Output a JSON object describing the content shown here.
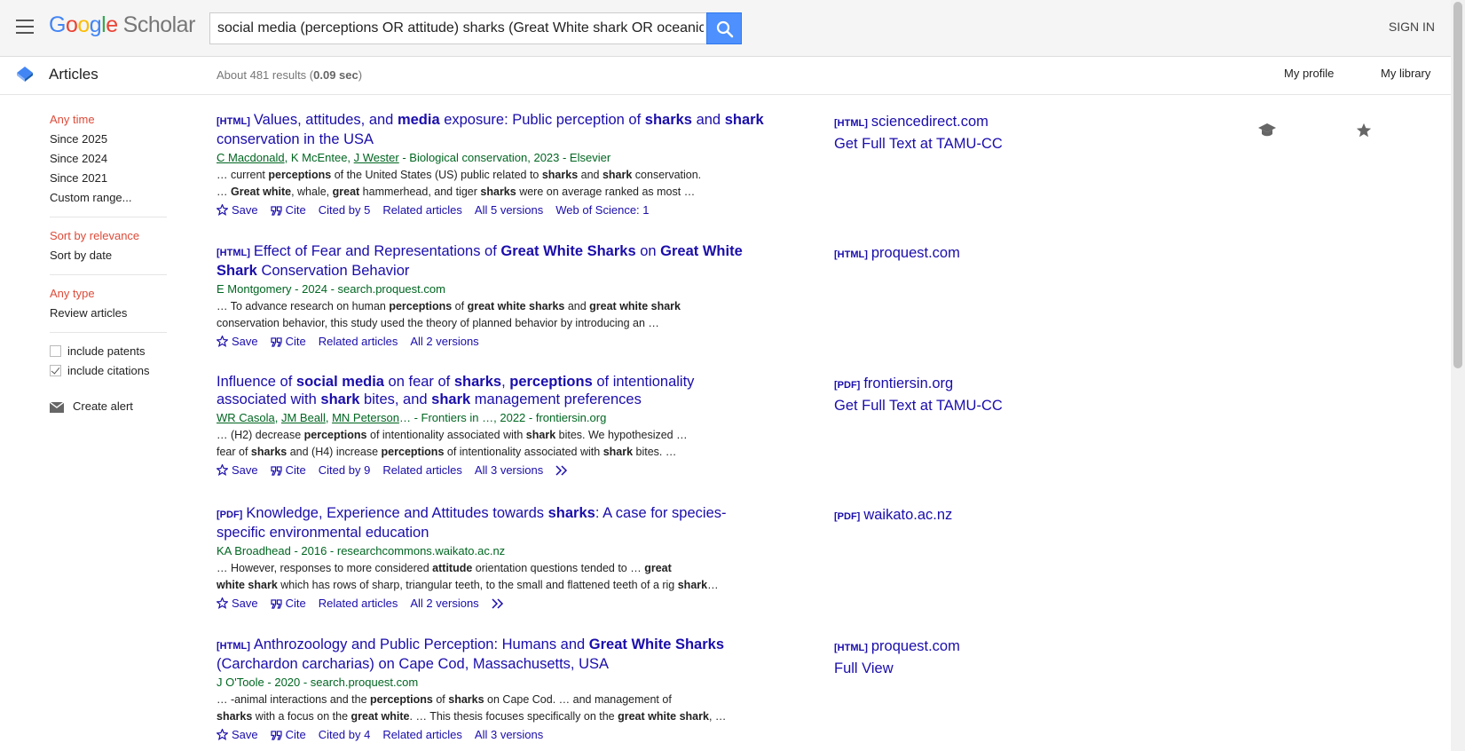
{
  "header": {
    "logo_google": "Google",
    "logo_scholar": "Scholar",
    "search_value": "social media (perceptions OR attitude) sharks (Great White shark OR oceanic",
    "sign_in": "SIGN IN"
  },
  "subheader": {
    "section": "Articles",
    "results_prefix": "About 481 results (",
    "results_time": "0.09 sec",
    "results_suffix": ")",
    "my_profile": "My profile",
    "my_library": "My library"
  },
  "sidebar": {
    "time": [
      "Any time",
      "Since 2025",
      "Since 2024",
      "Since 2021",
      "Custom range..."
    ],
    "sort": [
      "Sort by relevance",
      "Sort by date"
    ],
    "type": [
      "Any type",
      "Review articles"
    ],
    "include_patents": "include patents",
    "include_citations": "include citations",
    "create_alert": "Create alert"
  },
  "results": [
    {
      "tag": "[HTML]",
      "side": [
        "[HTML]",
        "sciencedirect.com",
        "Get Full Text at TAMU-CC"
      ],
      "links": {
        "save": "Save",
        "cite": "Cite",
        "cited": "Cited by 5",
        "related": "Related articles",
        "versions": "All 5 versions",
        "extra": "Web of Science: 1"
      }
    },
    {
      "tag": "[HTML]",
      "meta": "E Montgomery - 2024 - search.proquest.com",
      "side": [
        "[HTML]",
        "proquest.com"
      ],
      "links": {
        "save": "Save",
        "cite": "Cite",
        "related": "Related articles",
        "versions": "All 2 versions"
      }
    },
    {
      "side": [
        "[PDF]",
        "frontiersin.org",
        "Get Full Text at TAMU-CC"
      ],
      "links": {
        "save": "Save",
        "cite": "Cite",
        "cited": "Cited by 9",
        "related": "Related articles",
        "versions": "All 3 versions"
      }
    },
    {
      "tag": "[PDF]",
      "meta": "KA Broadhead - 2016 - researchcommons.waikato.ac.nz",
      "side": [
        "[PDF]",
        "waikato.ac.nz"
      ],
      "links": {
        "save": "Save",
        "cite": "Cite",
        "related": "Related articles",
        "versions": "All 2 versions"
      }
    },
    {
      "tag": "[HTML]",
      "meta": "J O'Toole - 2020 - search.proquest.com",
      "side": [
        "[HTML]",
        "proquest.com",
        "Full View"
      ],
      "links": {
        "save": "Save",
        "cite": "Cite",
        "cited": "Cited by 4",
        "related": "Related articles",
        "versions": "All 3 versions"
      }
    }
  ],
  "rich_text": {
    "r0_title": [
      "Values, attitudes, and ",
      "media",
      " exposure: Public perception of ",
      "sharks",
      " and ",
      "shark",
      " conservation in the USA"
    ],
    "r0_meta": [
      "C Macdonald",
      ", K McEntee, ",
      "J Wester",
      " - Biological conservation, 2023 - Elsevier"
    ],
    "r0_snip1": [
      "… current ",
      "perceptions",
      " of the United States (US) public related to ",
      "sharks",
      " and ",
      "shark",
      " conservation."
    ],
    "r0_snip2": [
      "… ",
      "Great white",
      ", whale, ",
      "great",
      " hammerhead, and tiger ",
      "sharks",
      " were on average ranked as most …"
    ],
    "r1_title": [
      "Effect of Fear and Representations of ",
      "Great White Sharks",
      " on ",
      "Great White Shark",
      " Conservation Behavior"
    ],
    "r1_snip1": [
      "… To advance research on human ",
      "perceptions",
      " of ",
      "great white sharks",
      " and ",
      "great white shark"
    ],
    "r1_snip2": [
      "conservation behavior, this study used the theory of planned behavior by introducing an …"
    ],
    "r2_title": [
      "Influence of ",
      "social media",
      " on fear of ",
      "sharks",
      ", ",
      "perceptions",
      " of intentionality associated with ",
      "shark",
      " bites, and ",
      "shark",
      " management preferences"
    ],
    "r2_meta": [
      "WR Casola",
      ", ",
      "JM Beall",
      ", ",
      "MN Peterson",
      "… - Frontiers in …, 2022 - frontiersin.org"
    ],
    "r2_snip1": [
      "… (H2) decrease ",
      "perceptions",
      " of intentionality associated with ",
      "shark",
      " bites. We hypothesized …"
    ],
    "r2_snip2": [
      "fear of ",
      "sharks",
      " and (H4) increase ",
      "perceptions",
      " of intentionality associated with ",
      "shark",
      " bites. …"
    ],
    "r3_title": [
      "Knowledge, Experience and Attitudes towards ",
      "sharks",
      ": A case for species-specific environmental education"
    ],
    "r3_snip1": [
      "… However, responses to more considered ",
      "attitude",
      " orientation questions tended to … ",
      "great"
    ],
    "r3_snip2": [
      "white shark",
      " which has rows of sharp, triangular teeth, to the small and flattened teeth of a rig ",
      "shark",
      "…"
    ],
    "r4_title": [
      "Anthrozoology and Public Perception: Humans and ",
      "Great White Sharks",
      " (Carchardon carcharias) on Cape Cod, Massachusetts, USA"
    ],
    "r4_snip1": [
      "… -animal interactions and the ",
      "perceptions",
      " of ",
      "sharks",
      " on Cape Cod. … and management of"
    ],
    "r4_snip2": [
      "sharks",
      " with a focus on the ",
      "great white",
      ". … This thesis focuses specifically on the ",
      "great white shark",
      ", …"
    ]
  },
  "colors": {
    "link": "#1a0dab",
    "meta_green": "#006621",
    "active_red": "#dd4b39",
    "search_blue": "#4d90fe"
  }
}
